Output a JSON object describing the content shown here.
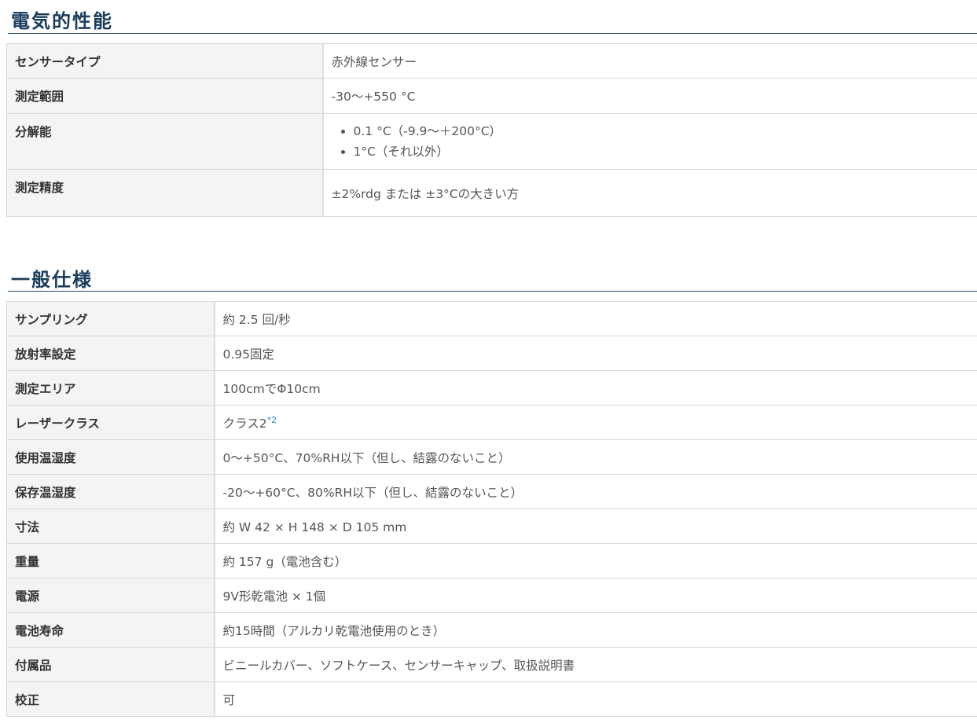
{
  "electrical": {
    "title": "電気的性能",
    "rows": {
      "sensor_type": {
        "label": "センサータイプ",
        "value": "赤外線センサー"
      },
      "range": {
        "label": "測定範囲",
        "value": "-30〜+550 °C"
      },
      "resolution": {
        "label": "分解能",
        "items": [
          "0.1 °C（-9.9〜＋200°C）",
          "1°C（それ以外）"
        ]
      },
      "accuracy": {
        "label": "測定精度",
        "value": "±2%rdg または ±3°Cの大きい方"
      }
    }
  },
  "general": {
    "title": "一般仕様",
    "rows": {
      "sampling": {
        "label": "サンプリング",
        "value": "約 2.5 回/秒"
      },
      "emissivity": {
        "label": "放射率設定",
        "value": "0.95固定"
      },
      "area": {
        "label": "測定エリア",
        "value": "100cmでΦ10cm"
      },
      "laser": {
        "label": "レーザークラス",
        "value": "クラス2",
        "note": "*2"
      },
      "op_env": {
        "label": "使用温湿度",
        "value": "0〜+50°C、70%RH以下（但し、結露のないこと）"
      },
      "storage_env": {
        "label": "保存温湿度",
        "value": "-20〜+60°C、80%RH以下（但し、結露のないこと）"
      },
      "dimensions": {
        "label": "寸法",
        "value": "約 W 42 × H 148 × D 105 mm"
      },
      "weight": {
        "label": "重量",
        "value": "約 157 g（電池含む）"
      },
      "power": {
        "label": "電源",
        "value": "9V形乾電池 × 1個"
      },
      "battery_life": {
        "label": "電池寿命",
        "value": "約15時間（アルカリ乾電池使用のとき）"
      },
      "accessories": {
        "label": "付属品",
        "value": "ビニールカバー、ソフトケース、センサーキャップ、取扱説明書"
      },
      "calibration": {
        "label": "校正",
        "value": "可"
      }
    }
  }
}
